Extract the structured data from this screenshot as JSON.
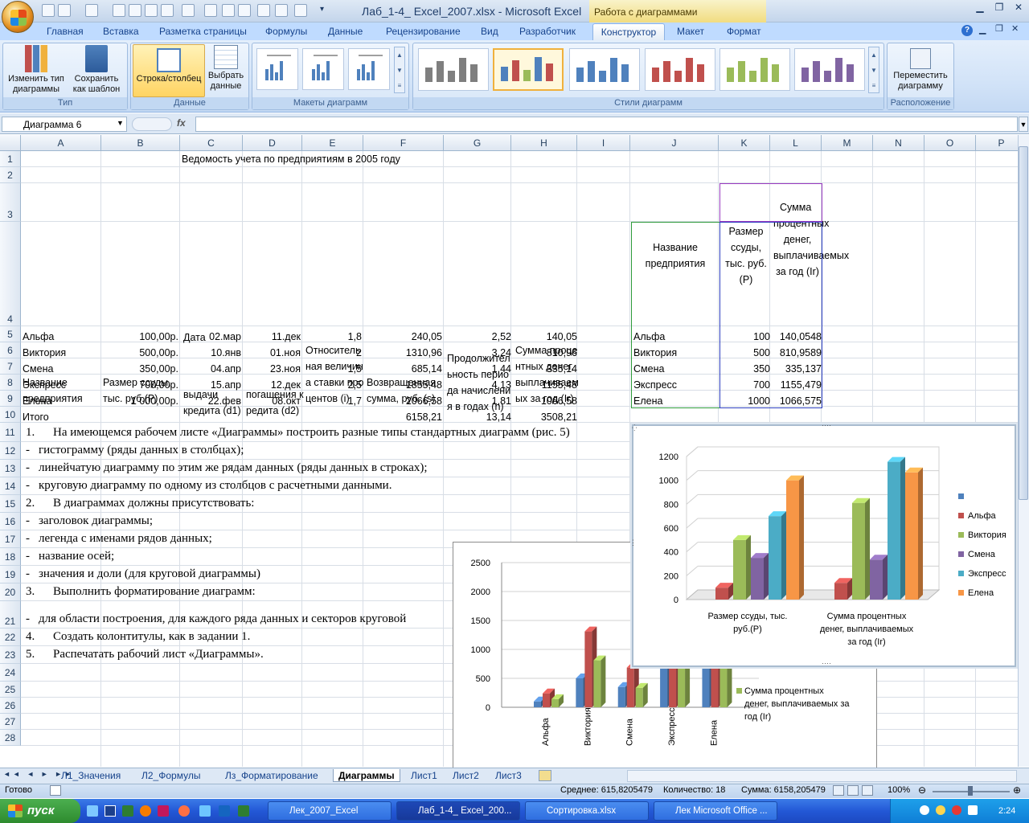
{
  "window": {
    "title": "Лаб_1-4_ Excel_2007.xlsx - Microsoft Excel",
    "context_tab_title": "Работа с диаграммами"
  },
  "ribbon": {
    "tabs": [
      "Главная",
      "Вставка",
      "Разметка страницы",
      "Формулы",
      "Данные",
      "Рецензирование",
      "Вид",
      "Разработчик",
      "Конструктор",
      "Макет",
      "Формат"
    ],
    "active_tab": "Конструктор",
    "groups": {
      "type": {
        "label": "Тип",
        "change_type": "Изменить тип диаграммы",
        "save_template": "Сохранить как шаблон"
      },
      "data": {
        "label": "Данные",
        "row_col": "Строка/столбец",
        "select_data": "Выбрать данные"
      },
      "layouts": {
        "label": "Макеты диаграмм"
      },
      "styles": {
        "label": "Стили диаграмм"
      },
      "location": {
        "label": "Расположение",
        "move_chart": "Переместить диаграмму"
      }
    },
    "style_colors": [
      "#7f7f7f",
      "#4f81bd",
      "#4f81bd",
      "#c0504d",
      "#9bbb59",
      "#8064a2"
    ]
  },
  "formula_bar": {
    "name_box": "Диаграмма 6",
    "fx": "fx",
    "value": ""
  },
  "columns": [
    "A",
    "B",
    "C",
    "D",
    "E",
    "F",
    "G",
    "H",
    "I",
    "J",
    "K",
    "L",
    "M",
    "N",
    "O",
    "P"
  ],
  "rows": [
    "1",
    "2",
    "3",
    "4",
    "5",
    "6",
    "7",
    "8",
    "9",
    "10",
    "11",
    "12",
    "13",
    "14",
    "15",
    "16",
    "17",
    "18",
    "19",
    "20",
    "21",
    "22",
    "23",
    "24",
    "25",
    "26",
    "27",
    "28"
  ],
  "sheet": {
    "title": "Ведомость учета по предприятиям в 2005 году",
    "headers": {
      "a": "Название предприятия",
      "b": "Размер ссуды, тыс. руб.(P)",
      "date": "Дата",
      "c": "выдачи кредита (d1)",
      "d": "погашения кредита (d2)",
      "e": "Относительная величина ставки процентов (i)",
      "f": "Возвращенная сумма, руб. (s)",
      "g": "Продолжительность периода начисления в годах (n)",
      "h": "Сумма процентных денег, выплачиваемых за год (Ir)"
    },
    "data": [
      {
        "name": "Альфа",
        "b": "100,00р.",
        "c": "02.мар",
        "d": "11.дек",
        "e": "1,8",
        "f": "240,05",
        "g": "2,52",
        "h": "140,05"
      },
      {
        "name": "Виктория",
        "b": "500,00р.",
        "c": "10.янв",
        "d": "01.ноя",
        "e": "2",
        "f": "1310,96",
        "g": "3,24",
        "h": "810,96"
      },
      {
        "name": "Смена",
        "b": "350,00р.",
        "c": "04.апр",
        "d": "23.ноя",
        "e": "1,5",
        "f": "685,14",
        "g": "1,44",
        "h": "335,14"
      },
      {
        "name": "Экспресс",
        "b": "700,00р.",
        "c": "15.апр",
        "d": "12.дек",
        "e": "2,5",
        "f": "1855,48",
        "g": "4,13",
        "h": "1155,48"
      },
      {
        "name": "Елена",
        "b": "1 000,00р.",
        "c": "22.фев",
        "d": "08.окт",
        "e": "1,7",
        "f": "2066,58",
        "g": "1,81",
        "h": "1066,58"
      }
    ],
    "total": {
      "label": "Итого",
      "f": "6158,21",
      "g": "13,14",
      "h": "3508,21"
    },
    "copy": {
      "j_header": "Название предприятия",
      "k_header": "Размер ссуды, тыс. руб.(P)",
      "l_top": "Сумма",
      "l_header": "процентных денег, выплачиваемых за год (Ir)",
      "rows": [
        {
          "name": "Альфа",
          "k": "100",
          "l": "140,0548"
        },
        {
          "name": "Виктория",
          "k": "500",
          "l": "810,9589"
        },
        {
          "name": "Смена",
          "k": "350",
          "l": "335,137"
        },
        {
          "name": "Экспресс",
          "k": "700",
          "l": "1155,479"
        },
        {
          "name": "Елена",
          "k": "1000",
          "l": "1066,575"
        }
      ]
    },
    "tasks": [
      {
        "n": "1.",
        "t": "На имеющемся рабочем листе «Диаграммы» построить разные типы стандартных диаграмм (рис. 5)"
      },
      {
        "n": "-",
        "t": "гистограмму (ряды данных в столбцах);"
      },
      {
        "n": "-",
        "t": "линейчатую диаграмму по этим же рядам данных (ряды данных в строках);"
      },
      {
        "n": "-",
        "t": "круговую диаграмму по одному из столбцов с расчетными данными."
      },
      {
        "n": "2.",
        "t": "В диаграммах должны присутствовать:"
      },
      {
        "n": "-",
        "t": "заголовок диаграммы;"
      },
      {
        "n": "-",
        "t": "легенда с именами рядов данных;"
      },
      {
        "n": "-",
        "t": "название осей;"
      },
      {
        "n": "-",
        "t": "значения и доли (для круговой диаграммы)"
      },
      {
        "n": "3.",
        "t": "Выполнить форматирование диаграмм:"
      },
      {
        "n": "-",
        "t": "для области построения, для каждого ряда данных  и секторов круговой"
      },
      {
        "n": "4.",
        "t": "Создать колонтитулы, как в задании 1."
      },
      {
        "n": "5.",
        "t": "Распечатать рабочий лист «Диаграммы»."
      }
    ]
  },
  "chart_data": [
    {
      "type": "bar",
      "categories": [
        "Альфа",
        "Виктория",
        "Смена",
        "Экспресс",
        "Елена"
      ],
      "series": [
        {
          "name": "",
          "values": [
            100,
            500,
            350,
            700,
            1000
          ],
          "color": "#4f81bd"
        },
        {
          "name": "",
          "values": [
            240.05,
            1310.96,
            685.14,
            1855.48,
            2066.58
          ],
          "color": "#c0504d"
        },
        {
          "name": "Сумма процентных денег, выплачиваемых за год (Ir)",
          "values": [
            140.05,
            810.96,
            335.14,
            1155.48,
            1066.58
          ],
          "color": "#9bbb59"
        }
      ],
      "yticks": [
        "0",
        "500",
        "1000",
        "1500",
        "2000",
        "2500"
      ],
      "ylim": [
        0,
        2500
      ]
    },
    {
      "type": "bar",
      "categories": [
        "Размер ссуды, тыс. руб.(P)",
        "Сумма процентных денег, выплачиваемых за год (Ir)"
      ],
      "series": [
        {
          "name": "",
          "values": [
            0,
            0
          ],
          "color": "#4f81bd"
        },
        {
          "name": "Альфа",
          "values": [
            100,
            140.05
          ],
          "color": "#c0504d"
        },
        {
          "name": "Виктория",
          "values": [
            500,
            810.96
          ],
          "color": "#9bbb59"
        },
        {
          "name": "Смена",
          "values": [
            350,
            335.14
          ],
          "color": "#8064a2"
        },
        {
          "name": "Экспресс",
          "values": [
            700,
            1155.48
          ],
          "color": "#4bacc6"
        },
        {
          "name": "Елена",
          "values": [
            1000,
            1066.58
          ],
          "color": "#f79646"
        }
      ],
      "yticks": [
        "0",
        "200",
        "400",
        "600",
        "800",
        "1000",
        "1200"
      ],
      "ylim": [
        0,
        1200
      ]
    }
  ],
  "sheet_tabs": [
    "Л1_Значения",
    "Л2_Формулы",
    "Лз_Форматирование",
    "Диаграммы",
    "Лист1",
    "Лист2",
    "Лист3"
  ],
  "active_sheet": "Диаграммы",
  "status": {
    "ready": "Готово",
    "average": "Среднее: 615,8205479",
    "count": "Количество: 18",
    "sum": "Сумма: 6158,205479",
    "zoom": "100%"
  },
  "taskbar": {
    "start": "пуск",
    "items": [
      "Лек_2007_Excel",
      "Лаб_1-4_ Excel_200...",
      "Сортировка.xlsx",
      "Лек Microsoft Office ..."
    ],
    "lang": "RU",
    "time": "2:24"
  }
}
